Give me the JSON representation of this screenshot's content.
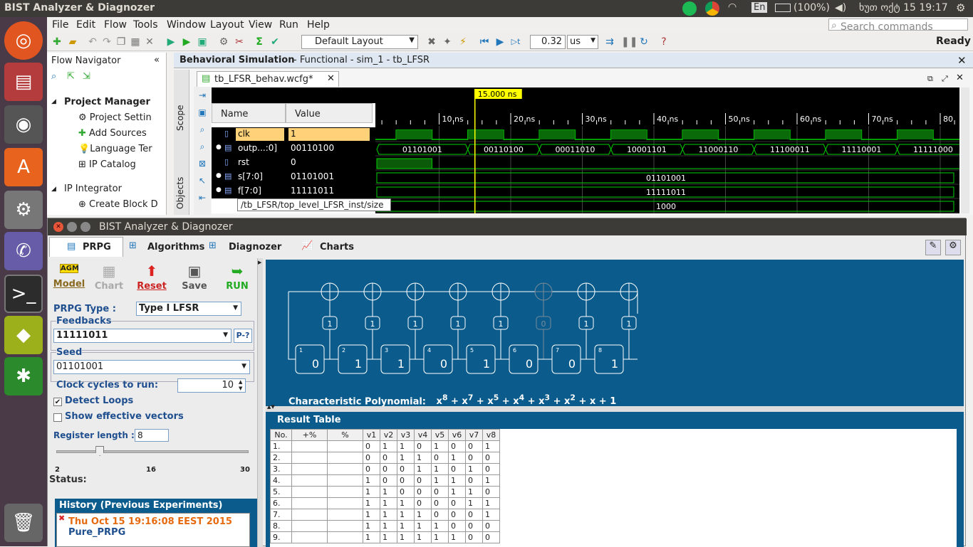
{
  "topbar": {
    "title": "BIST Analyzer & Diagnozer",
    "lang": "En",
    "battery": "(100%)",
    "clock": "ხუთ ოქტ 15 19:17"
  },
  "menu": [
    "File",
    "Edit",
    "Flow",
    "Tools",
    "Window",
    "Layout",
    "View",
    "Run",
    "Help"
  ],
  "toolbar": {
    "layout": "Default Layout",
    "time_value": "0.32",
    "time_unit": "us",
    "search_placeholder": "Search commands",
    "status": "Ready"
  },
  "flownav": {
    "title": "Flow Navigator",
    "project_manager": "Project Manager",
    "items": [
      "Project Settin",
      "Add Sources",
      "Language Ter",
      "IP Catalog"
    ],
    "ip_integrator": "IP Integrator",
    "create_block": "Create Block D"
  },
  "sim": {
    "title": "Behavioral Simulation",
    "subtitle": "- Functional - sim_1 - tb_LFSR",
    "tab": "tb_LFSR_behav.wcfg*",
    "scope_tab": "Scope",
    "objects_tab": "Objects",
    "col_name": "Name",
    "col_value": "Value",
    "cursor": "15.000 ns",
    "signals": [
      {
        "name": "clk",
        "value": "1"
      },
      {
        "name": "outp...:0]",
        "value": "00110100"
      },
      {
        "name": "rst",
        "value": "0"
      },
      {
        "name": "s[7:0]",
        "value": "01101001"
      },
      {
        "name": "f[7:0]",
        "value": "11111011"
      }
    ],
    "tooltip": "/tb_LFSR/top_level_LFSR_inst/size",
    "ticks": [
      "10 ns",
      "20 ns",
      "30 ns",
      "40 ns",
      "50 ns",
      "60 ns",
      "70 ns",
      "80"
    ],
    "outp_values": [
      "01101001",
      "00110100",
      "00011010",
      "10001101",
      "11000110",
      "11100011",
      "11110001",
      "11111000"
    ],
    "s_value": "01101001",
    "f_value": "11111011",
    "size_value": "1000"
  },
  "bist": {
    "title": "BIST Analyzer & Diagnozer",
    "tabs": [
      "PRPG",
      "Algorithms",
      "Diagnozer",
      "Charts"
    ],
    "actions": [
      "Model",
      "Chart",
      "Reset",
      "Save",
      "RUN"
    ],
    "prpg_type_label": "PRPG Type :",
    "prpg_type": "Type I LFSR",
    "feedbacks_label": "Feedbacks",
    "feedbacks": "11111011",
    "p_btn": "P-?",
    "seed_label": "Seed",
    "seed": "01101001",
    "clock_label": "Clock cycles to run:",
    "clock_value": "10",
    "detect_loops": "Detect Loops",
    "show_effective": "Show effective vectors",
    "reg_len_label": "Register length :",
    "reg_len": "8",
    "slider_labels": [
      "2",
      "16",
      "30"
    ],
    "slider_value": 0.21,
    "status_label": "Status:",
    "history_title": "History (Previous Experiments)",
    "history_entry": "Thu Oct 15 19:16:08 EEST 2015",
    "history_name": "Pure_PRPG",
    "feedback_bits": [
      "1",
      "1",
      "1",
      "1",
      "1",
      "0",
      "1",
      "1"
    ],
    "cells": [
      {
        "idx": "1",
        "val": "0"
      },
      {
        "idx": "2",
        "val": "1"
      },
      {
        "idx": "3",
        "val": "1"
      },
      {
        "idx": "4",
        "val": "0"
      },
      {
        "idx": "5",
        "val": "1"
      },
      {
        "idx": "6",
        "val": "0"
      },
      {
        "idx": "7",
        "val": "0"
      },
      {
        "idx": "8",
        "val": "1"
      }
    ],
    "poly_label": "Characteristic Polynomial:",
    "result_title": "Result Table",
    "result_headers": [
      "No.",
      "+%",
      "%",
      "v1",
      "v2",
      "v3",
      "v4",
      "v5",
      "v6",
      "v7",
      "v8"
    ],
    "rows": [
      [
        "1.",
        "",
        "",
        "0",
        "1",
        "1",
        "0",
        "1",
        "0",
        "0",
        "1"
      ],
      [
        "2.",
        "",
        "",
        "0",
        "0",
        "1",
        "1",
        "0",
        "1",
        "0",
        "0"
      ],
      [
        "3.",
        "",
        "",
        "0",
        "0",
        "0",
        "1",
        "1",
        "0",
        "1",
        "0"
      ],
      [
        "4.",
        "",
        "",
        "1",
        "0",
        "0",
        "0",
        "1",
        "1",
        "0",
        "1"
      ],
      [
        "5.",
        "",
        "",
        "1",
        "1",
        "0",
        "0",
        "0",
        "1",
        "1",
        "0"
      ],
      [
        "6.",
        "",
        "",
        "1",
        "1",
        "1",
        "0",
        "0",
        "0",
        "1",
        "1"
      ],
      [
        "7.",
        "",
        "",
        "1",
        "1",
        "1",
        "1",
        "0",
        "0",
        "0",
        "1"
      ],
      [
        "8.",
        "",
        "",
        "1",
        "1",
        "1",
        "1",
        "1",
        "0",
        "0",
        "0"
      ],
      [
        "9.",
        "",
        "",
        "1",
        "1",
        "1",
        "1",
        "1",
        "1",
        "0",
        "0"
      ]
    ]
  }
}
